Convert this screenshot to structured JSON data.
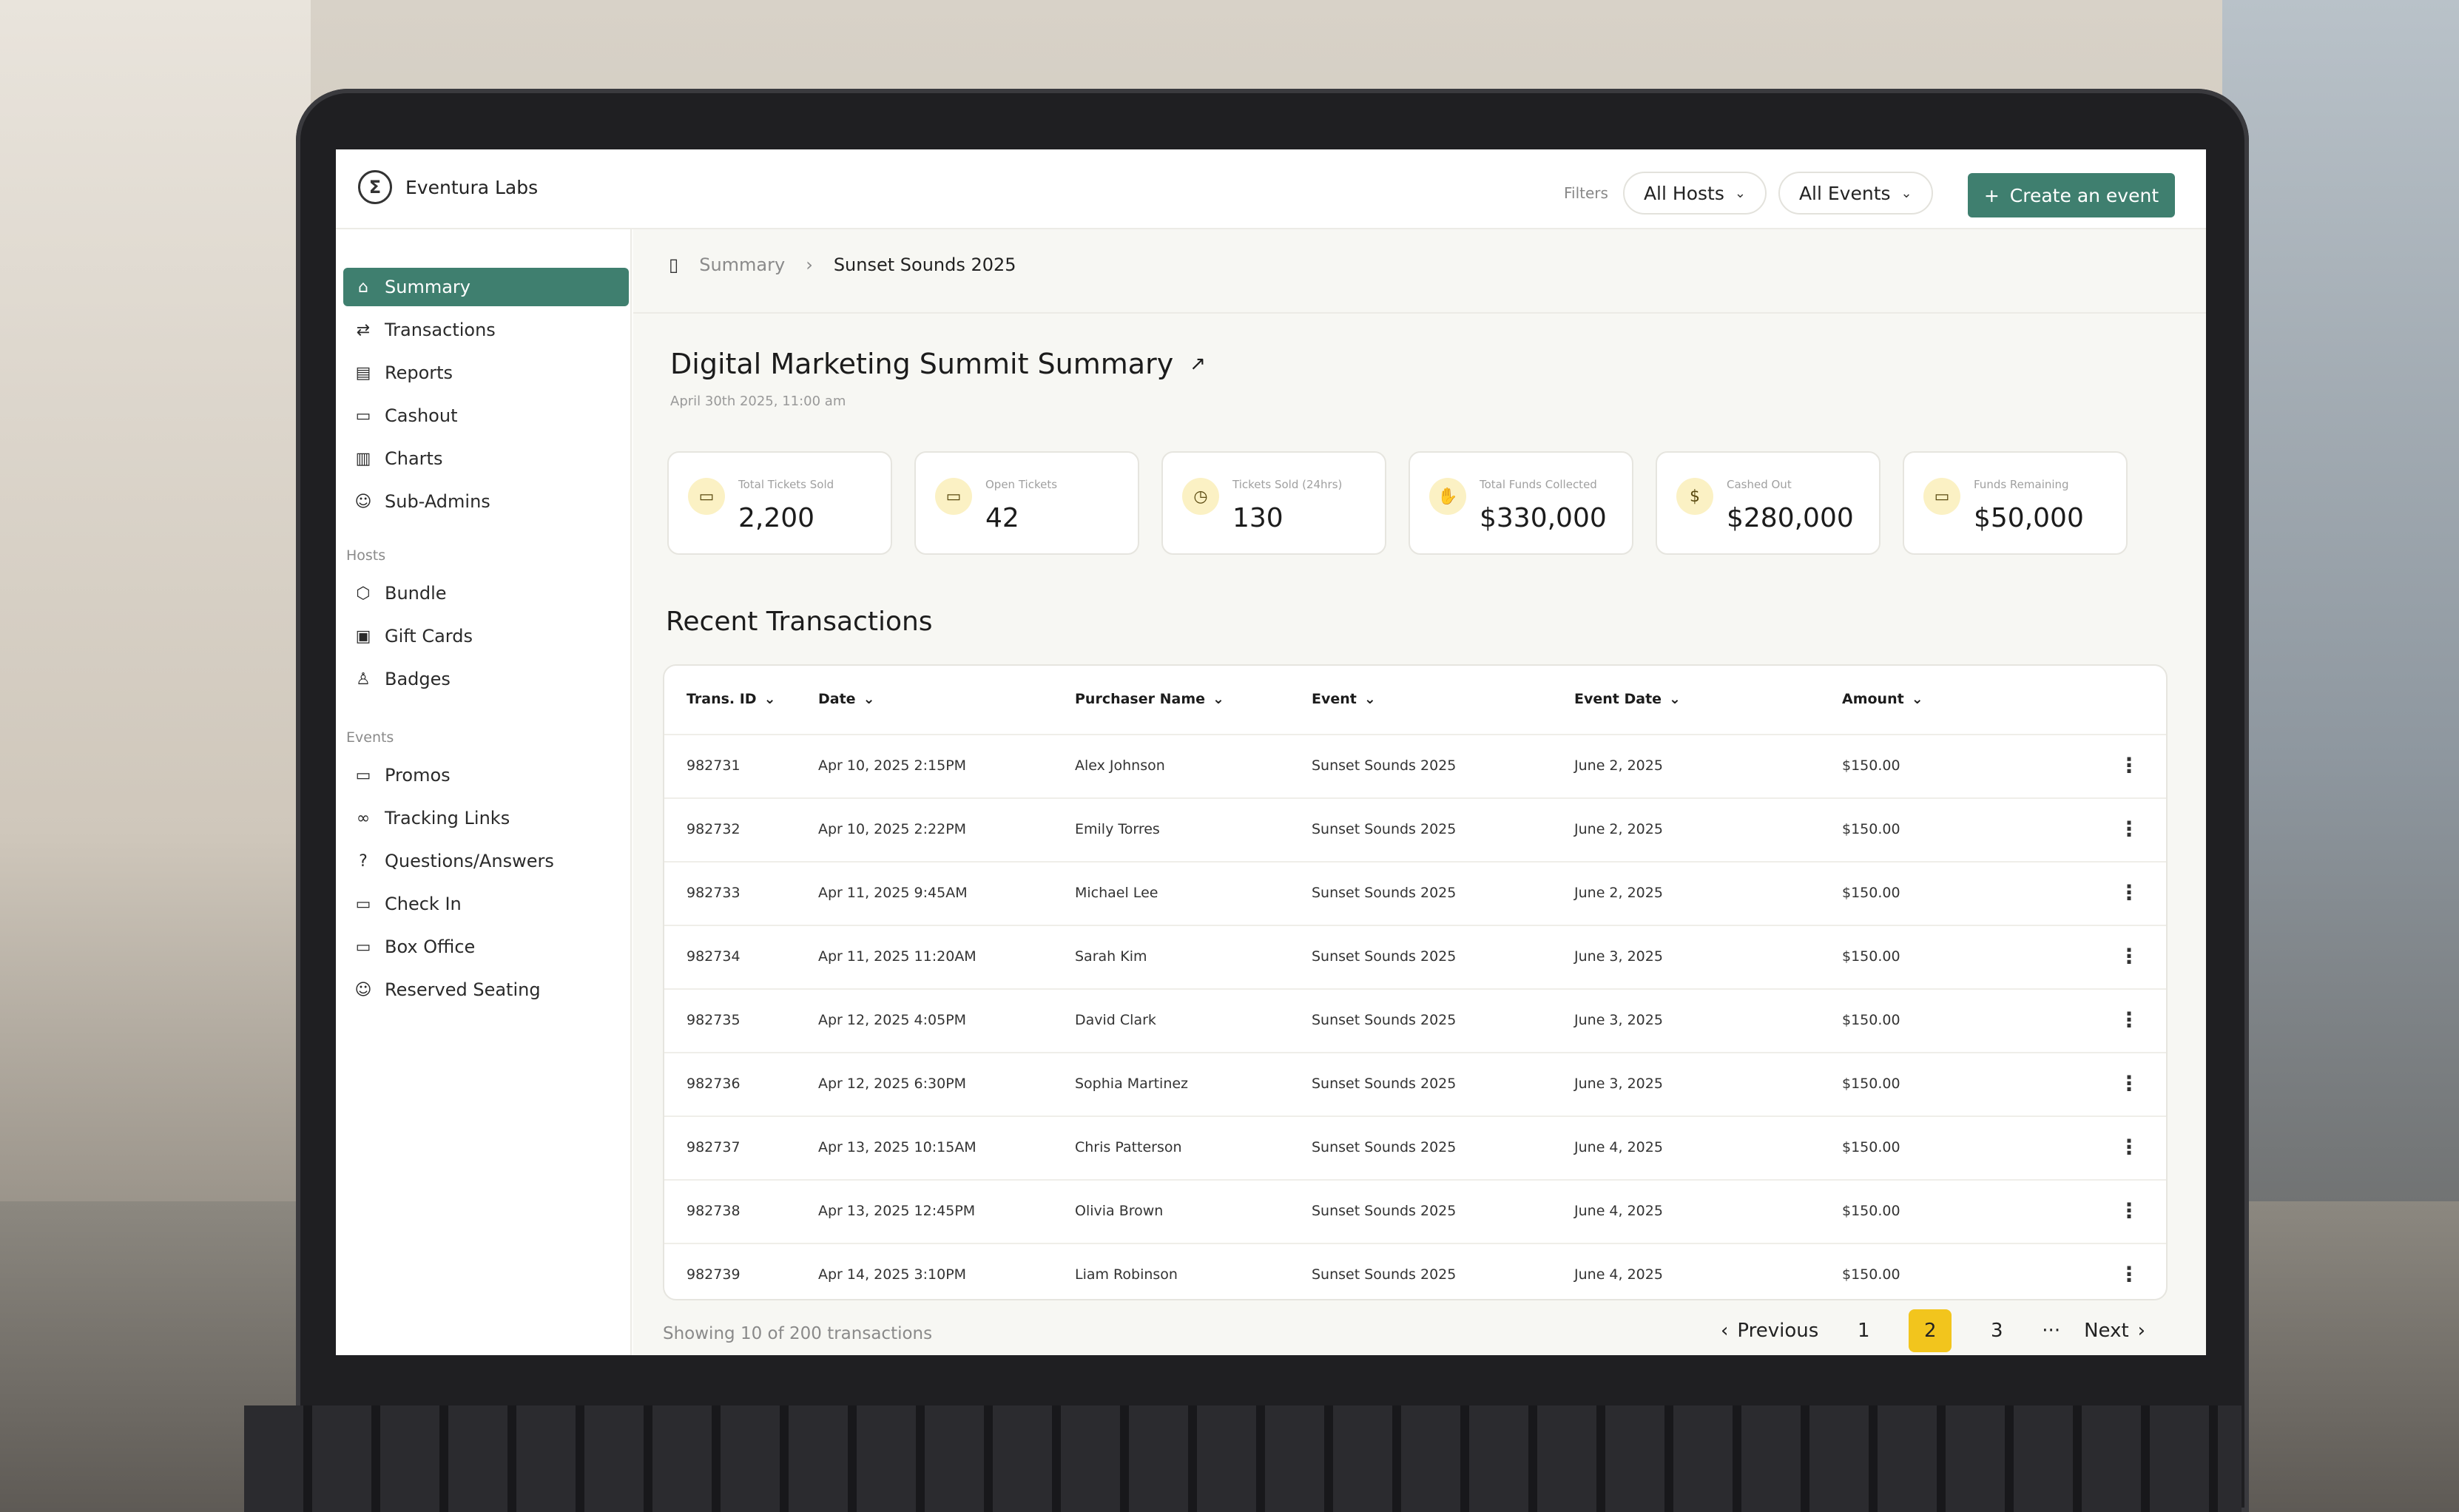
{
  "brand": {
    "name": "Eventura Labs",
    "logo_glyph": "Σ"
  },
  "topbar": {
    "filters_label": "Filters",
    "hosts_select": "All Hosts",
    "events_select": "All Events",
    "create_button": "Create an event"
  },
  "sidebar": {
    "items": [
      {
        "label": "Summary",
        "icon": "home-icon",
        "glyph": "⌂"
      },
      {
        "label": "Transactions",
        "icon": "arrows-swap-icon",
        "glyph": "⇄"
      },
      {
        "label": "Reports",
        "icon": "document-icon",
        "glyph": "▤"
      },
      {
        "label": "Cashout",
        "icon": "cash-icon",
        "glyph": "▭"
      },
      {
        "label": "Charts",
        "icon": "bar-chart-icon",
        "glyph": "▥"
      },
      {
        "label": "Sub-Admins",
        "icon": "user-icon",
        "glyph": "☺"
      }
    ],
    "hosts_label": "Hosts",
    "hosts_items": [
      {
        "label": "Bundle",
        "icon": "box-icon",
        "glyph": "⬡"
      },
      {
        "label": "Gift Cards",
        "icon": "gift-icon",
        "glyph": "▣"
      },
      {
        "label": "Badges",
        "icon": "badge-icon",
        "glyph": "♙"
      }
    ],
    "events_label": "Events",
    "events_items": [
      {
        "label": "Promos",
        "icon": "ticket-icon",
        "glyph": "▭"
      },
      {
        "label": "Tracking Links",
        "icon": "link-icon",
        "glyph": "∞"
      },
      {
        "label": "Questions/Answers",
        "icon": "question-icon",
        "glyph": "?"
      },
      {
        "label": "Check In",
        "icon": "ticket-icon",
        "glyph": "▭"
      },
      {
        "label": "Box Office",
        "icon": "ticket-icon",
        "glyph": "▭"
      },
      {
        "label": "Reserved Seating",
        "icon": "user-plus-icon",
        "glyph": "☺"
      }
    ]
  },
  "breadcrumb": {
    "parent": "Summary",
    "current": "Sunset Sounds 2025"
  },
  "page": {
    "title": "Digital Marketing Summit Summary",
    "subtitle": "April 30th 2025, 11:00 am"
  },
  "stats": [
    {
      "label": "Total Tickets Sold",
      "value": "2,200",
      "icon": "ticket-icon",
      "glyph": "▭"
    },
    {
      "label": "Open Tickets",
      "value": "42",
      "icon": "ticket-icon",
      "glyph": "▭"
    },
    {
      "label": "Tickets Sold (24hrs)",
      "value": "130",
      "icon": "clock-icon",
      "glyph": "◷"
    },
    {
      "label": "Total Funds Collected",
      "value": "$330,000",
      "icon": "coins-hand-icon",
      "glyph": "✋"
    },
    {
      "label": "Cashed Out",
      "value": "$280,000",
      "icon": "coin-icon",
      "glyph": "$"
    },
    {
      "label": "Funds Remaining",
      "value": "$50,000",
      "icon": "cash-icon",
      "glyph": "▭"
    }
  ],
  "transactions": {
    "title": "Recent Transactions",
    "columns": [
      "Trans. ID",
      "Date",
      "Purchaser Name",
      "Event",
      "Event Date",
      "Amount"
    ],
    "rows": [
      [
        "982731",
        "Apr 10, 2025 2:15PM",
        "Alex Johnson",
        "Sunset Sounds 2025",
        "June 2, 2025",
        "$150.00"
      ],
      [
        "982732",
        "Apr 10, 2025 2:22PM",
        "Emily Torres",
        "Sunset Sounds 2025",
        "June 2, 2025",
        "$150.00"
      ],
      [
        "982733",
        "Apr 11, 2025 9:45AM",
        "Michael Lee",
        "Sunset Sounds 2025",
        "June 2, 2025",
        "$150.00"
      ],
      [
        "982734",
        "Apr 11, 2025 11:20AM",
        "Sarah Kim",
        "Sunset Sounds 2025",
        "June 3, 2025",
        "$150.00"
      ],
      [
        "982735",
        "Apr 12, 2025 4:05PM",
        "David Clark",
        "Sunset Sounds 2025",
        "June 3, 2025",
        "$150.00"
      ],
      [
        "982736",
        "Apr 12, 2025 6:30PM",
        "Sophia Martinez",
        "Sunset Sounds 2025",
        "June 3, 2025",
        "$150.00"
      ],
      [
        "982737",
        "Apr 13, 2025 10:15AM",
        "Chris Patterson",
        "Sunset Sounds 2025",
        "June 4, 2025",
        "$150.00"
      ],
      [
        "982738",
        "Apr 13, 2025 12:45PM",
        "Olivia Brown",
        "Sunset Sounds 2025",
        "June 4, 2025",
        "$150.00"
      ],
      [
        "982739",
        "Apr 14, 2025 3:10PM",
        "Liam Robinson",
        "Sunset Sounds 2025",
        "June 4, 2025",
        "$150.00"
      ]
    ],
    "showing": "Showing 10 of 200 transactions"
  },
  "pagination": {
    "previous": "Previous",
    "pages": [
      "1",
      "2",
      "3"
    ],
    "current": "2",
    "ellipsis": "···",
    "next": "Next"
  },
  "colors": {
    "accent": "#3f7f6f",
    "highlight": "#f2c51d",
    "icon_bg": "#fbf1c4"
  }
}
